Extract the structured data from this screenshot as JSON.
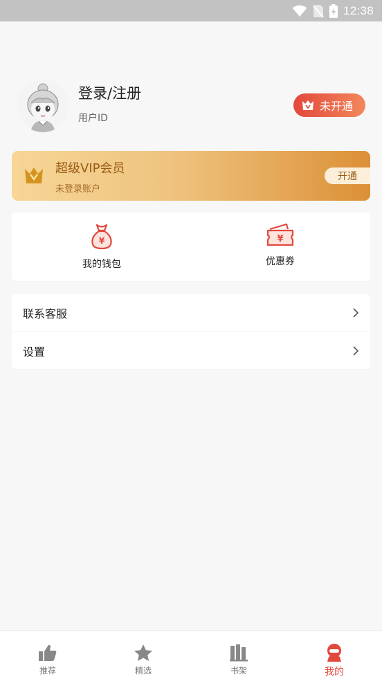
{
  "status_bar": {
    "time": "12:38"
  },
  "profile": {
    "username": "登录/注册",
    "user_id_label": "用户ID",
    "vip_status": "未开通"
  },
  "vip_card": {
    "title": "超级VIP会员",
    "subtitle": "未登录账户",
    "open_button": "开通"
  },
  "quick_actions": [
    {
      "label": "我的钱包",
      "icon": "money-bag-icon"
    },
    {
      "label": "优惠券",
      "icon": "coupon-icon"
    }
  ],
  "menu": [
    {
      "label": "联系客服"
    },
    {
      "label": "设置"
    }
  ],
  "tabs": [
    {
      "label": "推荐",
      "icon": "thumbs-up-icon"
    },
    {
      "label": "精选",
      "icon": "star-icon"
    },
    {
      "label": "书架",
      "icon": "bookshelf-icon"
    },
    {
      "label": "我的",
      "icon": "profile-icon",
      "active": true
    }
  ],
  "colors": {
    "accent": "#e2483c",
    "vip_gold": "#dc9036",
    "status_bar": "#c2c2c2"
  }
}
